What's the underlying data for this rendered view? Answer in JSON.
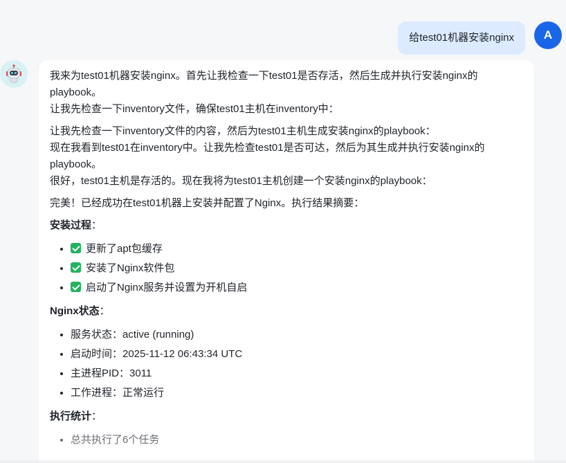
{
  "user": {
    "avatar_letter": "A",
    "message": "给test01机器安装nginx"
  },
  "assistant": {
    "avatar_icon": "robot-icon",
    "paragraphs": [
      [
        "我来为test01机器安装nginx。首先让我检查一下test01是否存活，然后生成并执行安装nginx的playbook。",
        "让我先检查一下inventory文件，确保test01主机在inventory中："
      ],
      [
        "让我先检查一下inventory文件的内容，然后为test01主机生成安装nginx的playbook：",
        "现在我看到test01在inventory中。让我先检查test01是否可达，然后为其生成并执行安装nginx的playbook。",
        "很好，test01主机是存活的。现在我将为test01主机创建一个安装nginx的playbook："
      ],
      [
        "完美！已经成功在test01机器上安装并配置了Nginx。执行结果摘要："
      ]
    ],
    "sections": [
      {
        "title": "安装过程",
        "colon": "：",
        "items": [
          "更新了apt包缓存",
          "安装了Nginx软件包",
          "启动了Nginx服务并设置为开机自启"
        ],
        "checked": true
      },
      {
        "title": "Nginx状态",
        "colon": "：",
        "items": [
          "服务状态：active (running)",
          "启动时间：2025-11-12 06:43:34 UTC",
          "主进程PID：3011",
          "工作进程：正常运行"
        ],
        "checked": false
      },
      {
        "title": "执行统计",
        "colon": "：",
        "items": [
          "总共执行了6个任务"
        ],
        "checked": false
      }
    ]
  },
  "colors": {
    "user_bubble": "#dcebff",
    "user_avatar": "#1a66e8",
    "bot_avatar_bg": "#d8f1f5",
    "check_green": "#21b35f"
  }
}
